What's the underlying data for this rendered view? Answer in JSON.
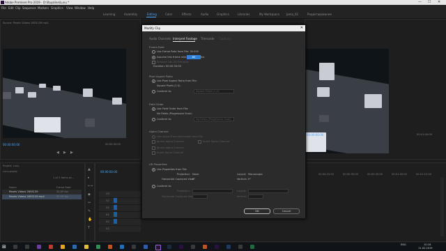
{
  "window": {
    "title": "Adobe Premiere Pro 2019 - D:\\Rayaline\\Lunu *",
    "minimize": "—",
    "maximize": "☐",
    "close": "✕"
  },
  "menu": [
    "File",
    "Edit",
    "Clip",
    "Sequence",
    "Markers",
    "Graphics",
    "View",
    "Window",
    "Help"
  ],
  "workspaces": [
    {
      "label": "Learning",
      "active": false
    },
    {
      "label": "Assembly",
      "active": false
    },
    {
      "label": "Editing",
      "active": true
    },
    {
      "label": "Color",
      "active": false
    },
    {
      "label": "Effects",
      "active": false
    },
    {
      "label": "Audio",
      "active": false
    },
    {
      "label": "Graphics",
      "active": false
    },
    {
      "label": "Libraries",
      "active": false
    },
    {
      "label": "My Workspace",
      "active": false
    },
    {
      "label": "Jama_02",
      "active": false
    },
    {
      "label": "Редактирование",
      "active": false
    }
  ],
  "source_panel": {
    "title": "Source: Pexels Videos 2655139.mp4",
    "timecode": "00:00:00:00",
    "end_timecode": "00:00:30:00"
  },
  "program_panel": {
    "timecode": "00:00:00:00",
    "end_timecode": "00:01:00:00"
  },
  "project_panel": {
    "title": "Project: Lunu",
    "name_col": "Name",
    "rate_col": "Frame Rate",
    "file": "Lunu.prproj",
    "count": "1 of 2 items se...",
    "items": [
      {
        "name": "Pexels Videos 2655139",
        "rate": "30.00 fps"
      },
      {
        "name": "Pexels Videos 2655139.mp4",
        "rate": "30.00 fps"
      }
    ]
  },
  "timeline": {
    "timecode": "00:00:00:00",
    "ruler": [
      "00:00",
      "00:00:15:00",
      "00:00:30:00",
      "00:00:45:00",
      "00:01:00:00",
      "00:01:15:00",
      "00:01:30:00"
    ],
    "tracks": [
      "V3",
      "V2",
      "V1",
      "A1",
      "A2",
      "A3"
    ]
  },
  "dialog": {
    "title": "Modify Clip",
    "close": "✕",
    "tabs": [
      {
        "label": "Audio Channels",
        "active": false
      },
      {
        "label": "Interpret Footage",
        "active": true
      },
      {
        "label": "Timecode",
        "active": false
      },
      {
        "label": "Captions",
        "active": false
      }
    ],
    "frame_rate": {
      "header": "Frame Rate",
      "use_file": "Use Frame Rate from File: 30.000",
      "assume": "Assume this frame rate:",
      "value": "60",
      "unit": "fps",
      "remove_pulldown": "Remove 24p DV Pulldown",
      "duration": "Duration:  00:00:30:00"
    },
    "pixel_aspect": {
      "header": "Pixel Aspect Ratio",
      "use_file": "Use Pixel Aspect Ratio from File:",
      "file_value": "Square Pixels (1.0)",
      "conform": "Conform to:",
      "conform_value": "Square Pixels (1.0)"
    },
    "field_order": {
      "header": "Field Order",
      "use_file": "Use Field Order from File:",
      "file_value": "No Fields (Progressive Scan)",
      "conform": "Conform to:",
      "conform_value": "No Fields (Progressive Scan)"
    },
    "alpha": {
      "header": "Alpha Channel",
      "premultiplied": "Use Alpha Premultiplication from File",
      "ignore": "Ignore Alpha Channel",
      "invert": "Invert Alpha Channel",
      "opt1": "Ignore Alpha Channel",
      "opt2": "Invert Alpha Channel"
    },
    "vr": {
      "header": "VR Properties",
      "use_file": "Use Properties from File",
      "projection": "Projection:",
      "projection_value": "None",
      "layout": "Layout:",
      "layout_value": "Monoscopic",
      "h_captured": "Horizontal Captured View:",
      "h_value": "0°",
      "vertical": "Vertical:",
      "v_value": "0°",
      "conform": "Conform to:",
      "projection2": "Projection:",
      "layout2": "Layout:",
      "h_captured2": "Horizontal Captured View:",
      "vertical2": "Vertical:"
    },
    "ok": "OK",
    "cancel": "Cancel"
  },
  "taskbar": {
    "time": "10:16",
    "date": "11.02.2019",
    "lang": "ENG"
  }
}
